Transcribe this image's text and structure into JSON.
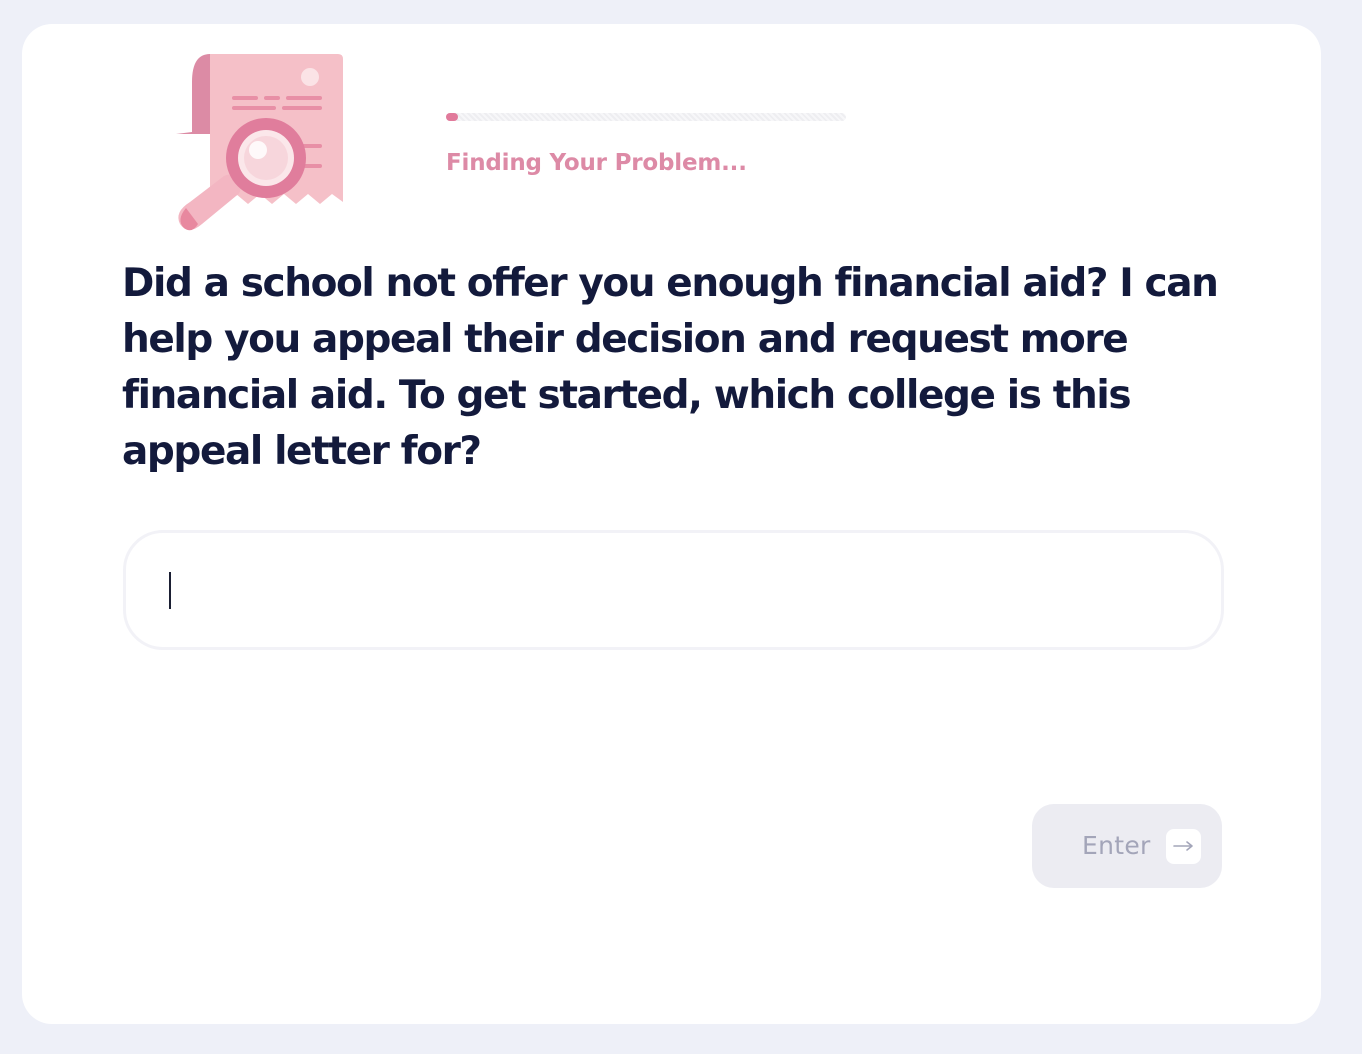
{
  "progress": {
    "status": "Finding Your Problem...",
    "fraction": 0.03,
    "fill_color": "#e17a9b"
  },
  "illustration": {
    "icon": "receipt-magnifier-icon"
  },
  "question": {
    "text": "Did a school not offer you enough financial aid? I can help you appeal their decision and request more financial aid. To get started, which college is this appeal letter for?"
  },
  "answer": {
    "value": "",
    "placeholder": ""
  },
  "enter_button": {
    "label": "Enter",
    "icon": "arrow-right-icon"
  },
  "colors": {
    "background": "#eef0f8",
    "card": "#ffffff",
    "heading": "#131a3c",
    "accent_pink": "#dd8aa6",
    "button_disabled": "#ececf2"
  }
}
